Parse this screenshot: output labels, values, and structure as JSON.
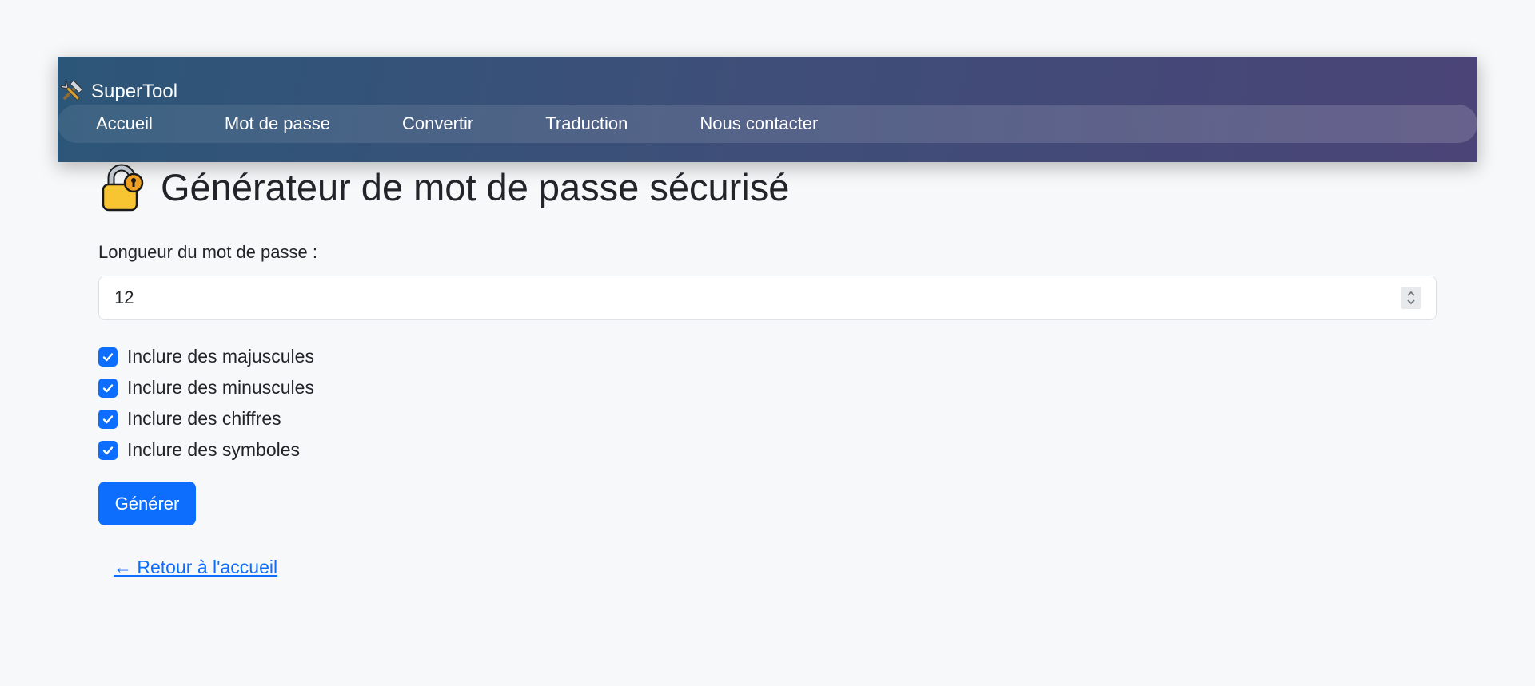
{
  "navbar": {
    "brand": "SuperTool",
    "brand_icon": "hammer-and-wrench-icon",
    "links": [
      "Accueil",
      "Mot de passe",
      "Convertir",
      "Traduction",
      "Nous contacter"
    ],
    "gradient_start": "#2c5678",
    "gradient_end": "#4a4477"
  },
  "main": {
    "title_icon": "lock-icon",
    "title": "Générateur de mot de passe sécurisé",
    "length_label": "Longueur du mot de passe :",
    "length_value": "12",
    "options": [
      {
        "label": "Inclure des majuscules",
        "checked": true
      },
      {
        "label": "Inclure des minuscules",
        "checked": true
      },
      {
        "label": "Inclure des chiffres",
        "checked": true
      },
      {
        "label": "Inclure des symboles",
        "checked": true
      }
    ],
    "generate_label": "Générer",
    "back_link": "← Retour à l'accueil"
  },
  "colors": {
    "accent": "#0d6efd",
    "background": "#f7f8fa"
  }
}
